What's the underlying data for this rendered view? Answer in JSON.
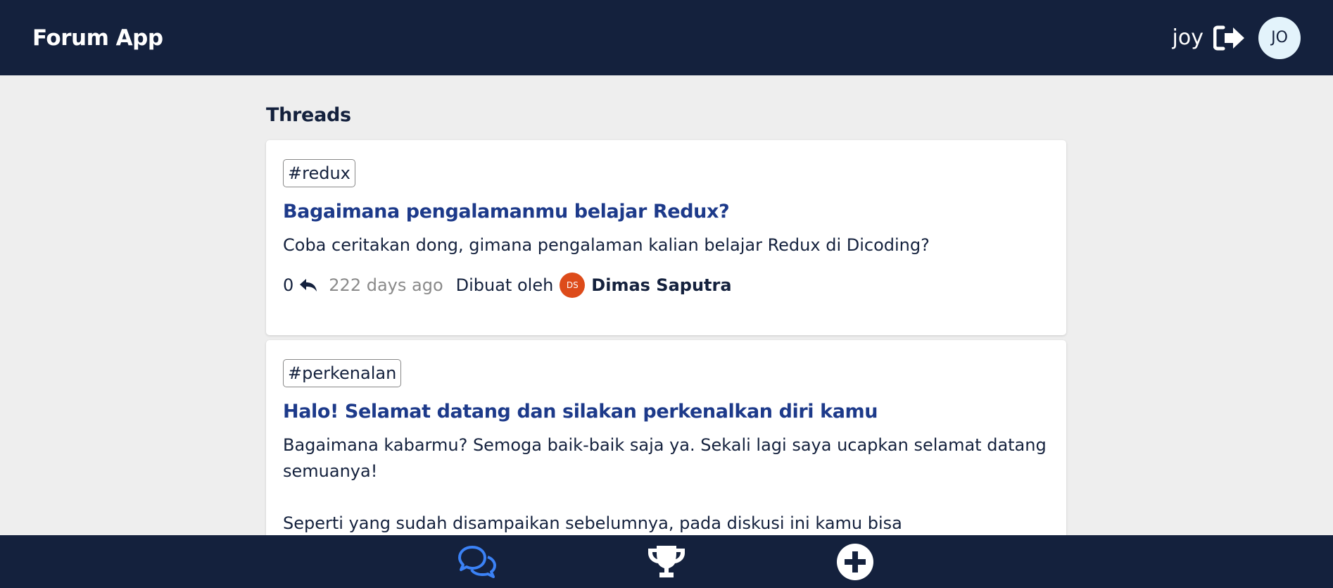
{
  "header": {
    "brand": "Forum App",
    "user_name": "joy",
    "avatar_initials": "JO"
  },
  "main": {
    "section_title": "Threads",
    "threads": [
      {
        "category": "#redux",
        "title": "Bagaimana pengalamanmu belajar Redux?",
        "body_lines": [
          "Coba ceritakan dong, gimana pengalaman kalian belajar Redux di Dicoding?"
        ],
        "reply_count": "0",
        "time_ago": "222 days ago",
        "created_by_label": "Dibuat oleh",
        "owner_initials": "DS",
        "owner_name": "Dimas Saputra"
      },
      {
        "category": "#perkenalan",
        "title": "Halo! Selamat datang dan silakan perkenalkan diri kamu",
        "body_lines": [
          "Bagaimana kabarmu? Semoga baik-baik saja ya. Sekali lagi saya ucapkan selamat datang semuanya!",
          "Seperti yang sudah disampaikan sebelumnya, pada diskusi ini kamu bisa"
        ]
      }
    ]
  },
  "colors": {
    "navbar": "#14213d",
    "title_link": "#1d3a8a",
    "active_nav": "#3b82f6",
    "owner_avatar": "#dd4b1a",
    "background": "#eeeeee"
  },
  "bottom_nav": {
    "items": [
      {
        "icon": "threads-icon",
        "active": true
      },
      {
        "icon": "leaderboard-trophy-icon",
        "active": false
      },
      {
        "icon": "add-thread-icon",
        "active": false
      }
    ]
  }
}
